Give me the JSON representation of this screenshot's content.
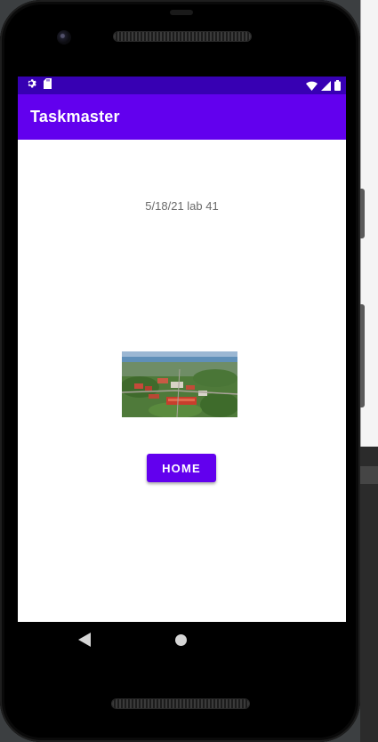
{
  "status_bar": {
    "left_icons": [
      "gear-icon",
      "sd-card-icon"
    ],
    "right_icons": [
      "wifi-icon",
      "signal-icon",
      "battery-icon"
    ]
  },
  "app_bar": {
    "title": "Taskmaster"
  },
  "main": {
    "date_label": "5/18/21 lab 41",
    "image": "aerial-campus-photo",
    "home_button_label": "HOME"
  },
  "nav_bar": {
    "icons": [
      "back-icon",
      "home-icon"
    ]
  },
  "colors": {
    "primary": "#6200ee",
    "primary_dark": "#3700b3",
    "button_text": "#ffffff",
    "body_text": "#6b6b6b"
  }
}
